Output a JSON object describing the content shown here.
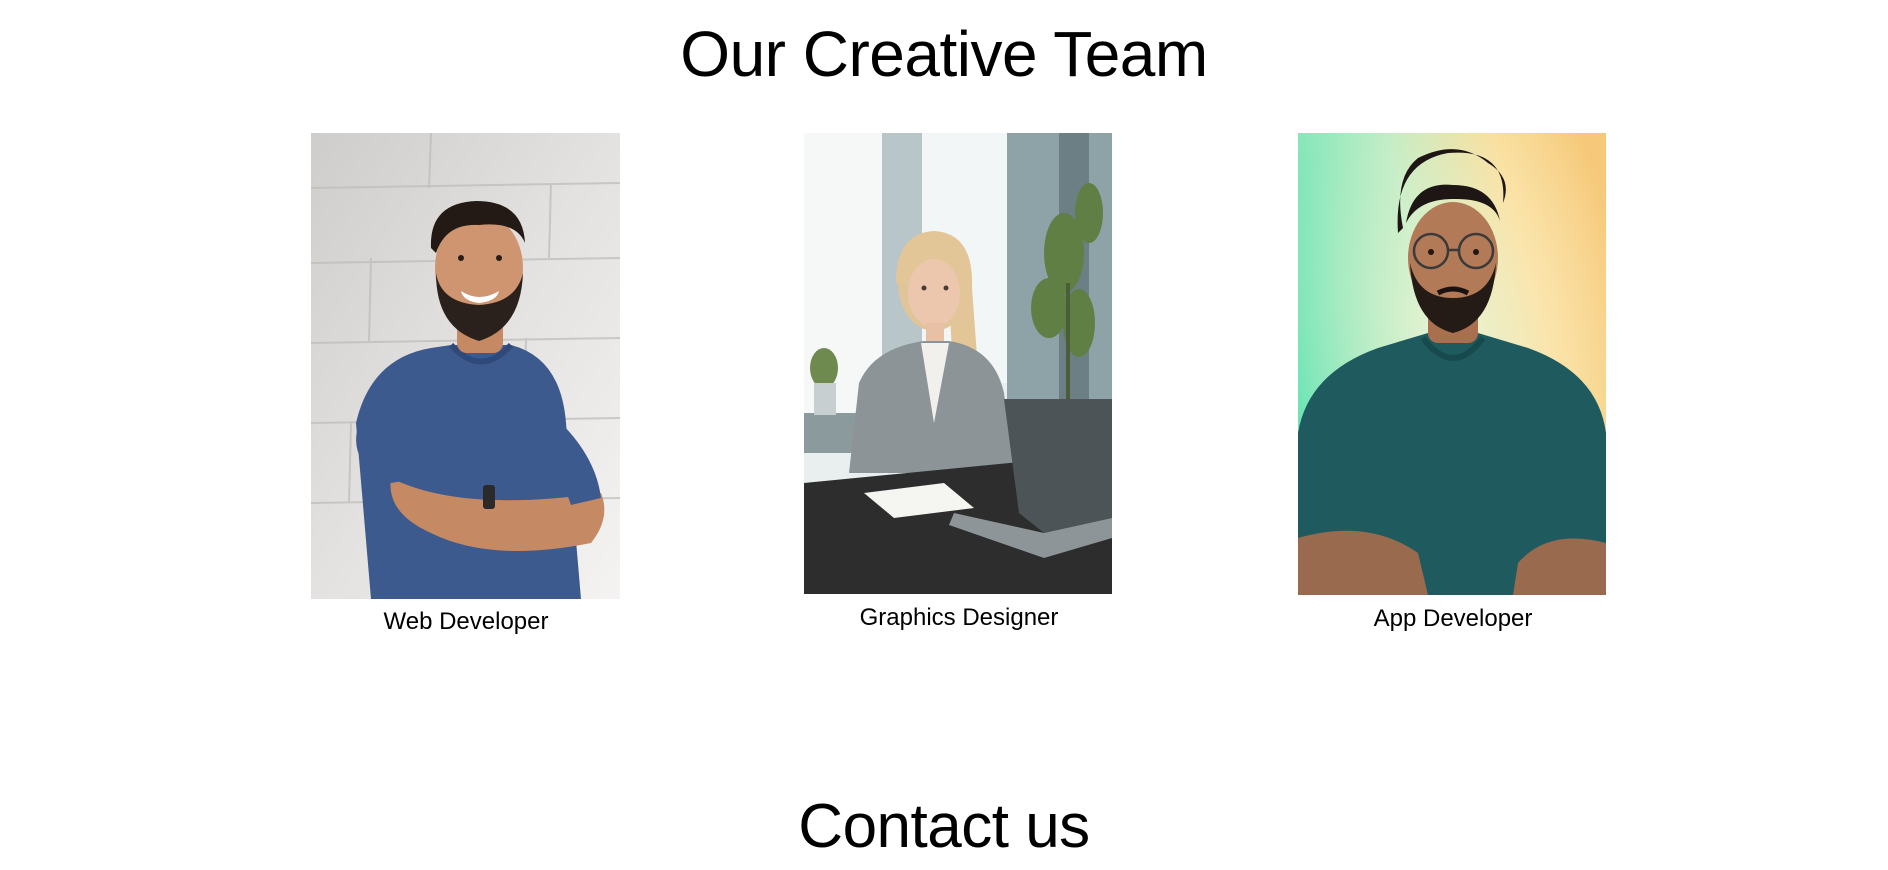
{
  "team": {
    "title": "Our Creative Team",
    "members": [
      {
        "role": "Web Developer",
        "photo": "smiling-man-blue-tshirt-photo"
      },
      {
        "role": "Graphics Designer",
        "photo": "woman-at-laptop-office-photo"
      },
      {
        "role": "App Developer",
        "photo": "man-glasses-teal-tshirt-photo"
      }
    ]
  },
  "contact": {
    "title": "Contact us"
  }
}
